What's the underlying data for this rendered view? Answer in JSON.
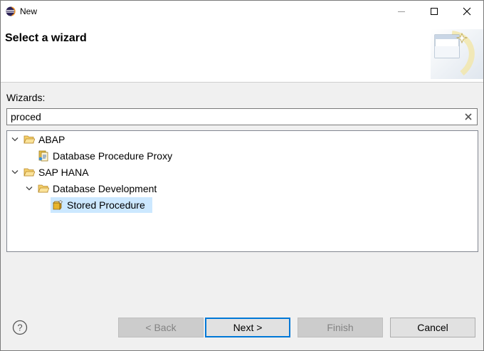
{
  "window": {
    "title": "New"
  },
  "header": {
    "title": "Select a wizard"
  },
  "wizards": {
    "label": "Wizards:",
    "filter_value": "proced",
    "tree": [
      {
        "label": "ABAP",
        "level": 0,
        "expanded": true,
        "icon": "folder-open-icon"
      },
      {
        "label": "Database Procedure Proxy",
        "level": 1,
        "icon": "procedure-proxy-icon"
      },
      {
        "label": "SAP HANA",
        "level": 0,
        "expanded": true,
        "icon": "folder-open-icon"
      },
      {
        "label": "Database Development",
        "level": 1,
        "expanded": true,
        "icon": "folder-open-icon"
      },
      {
        "label": "Stored Procedure",
        "level": 2,
        "selected": true,
        "icon": "stored-procedure-icon"
      }
    ]
  },
  "buttons": {
    "back": "< Back",
    "next": "Next >",
    "finish": "Finish",
    "cancel": "Cancel"
  },
  "colors": {
    "selection": "#cce8ff",
    "default_button_border": "#0078d7",
    "folder": "#e8b84a"
  }
}
